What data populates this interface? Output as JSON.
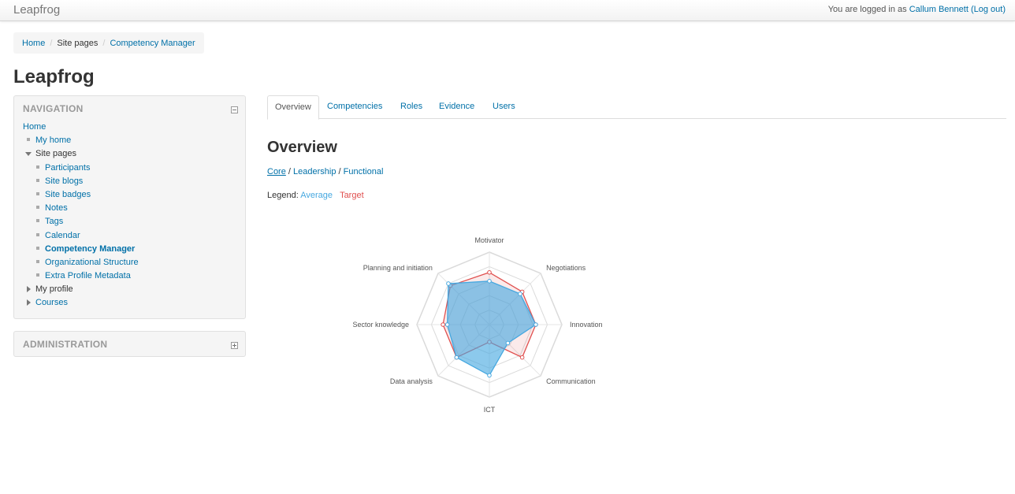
{
  "app": {
    "brand": "Leapfrog",
    "login_prefix": "You are logged in as",
    "user": "Callum Bennett",
    "logout": "(Log out)"
  },
  "breadcrumb": [
    "Home",
    "Site pages",
    "Competency Manager"
  ],
  "page_title": "Leapfrog",
  "navigation": {
    "title": "NAVIGATION",
    "items": [
      {
        "label": "Home",
        "level": 0
      },
      {
        "label": "My home",
        "level": 1
      },
      {
        "label": "Site pages",
        "level": 1,
        "expanded": true
      },
      {
        "label": "Participants",
        "level": 2
      },
      {
        "label": "Site blogs",
        "level": 2
      },
      {
        "label": "Site badges",
        "level": 2
      },
      {
        "label": "Notes",
        "level": 2
      },
      {
        "label": "Tags",
        "level": 2
      },
      {
        "label": "Calendar",
        "level": 2
      },
      {
        "label": "Competency Manager",
        "level": 2,
        "active": true
      },
      {
        "label": "Organizational Structure",
        "level": 2
      },
      {
        "label": "Extra Profile Metadata",
        "level": 2
      },
      {
        "label": "My profile",
        "level": 1,
        "collapsed": true
      },
      {
        "label": "Courses",
        "level": 1,
        "collapsed": true
      }
    ]
  },
  "administration": {
    "title": "ADMINISTRATION"
  },
  "tabs": [
    {
      "label": "Overview",
      "active": true
    },
    {
      "label": "Competencies"
    },
    {
      "label": "Roles"
    },
    {
      "label": "Evidence"
    },
    {
      "label": "Users"
    }
  ],
  "overview": {
    "title": "Overview",
    "filters": [
      "Core",
      "Leadership",
      "Functional"
    ],
    "filter_sep": "/",
    "legend_label": "Legend:",
    "legend_average": "Average",
    "legend_target": "Target"
  },
  "colors": {
    "average": "#46a8e0",
    "target": "#e0504f",
    "link": "#0070a8"
  },
  "chart_data": {
    "type": "radar",
    "axes": [
      "Motivator",
      "Negotiations",
      "Innovation",
      "Communication",
      "ICT",
      "Data analysis",
      "Sector knowledge",
      "Planning and initiation"
    ],
    "max": 5,
    "series": [
      {
        "name": "Average",
        "values": [
          3.0,
          3.0,
          3.2,
          1.8,
          3.5,
          3.2,
          2.9,
          4.0
        ]
      },
      {
        "name": "Target",
        "values": [
          3.6,
          3.2,
          3.2,
          3.2,
          1.2,
          3.2,
          3.2,
          3.8
        ]
      }
    ]
  }
}
